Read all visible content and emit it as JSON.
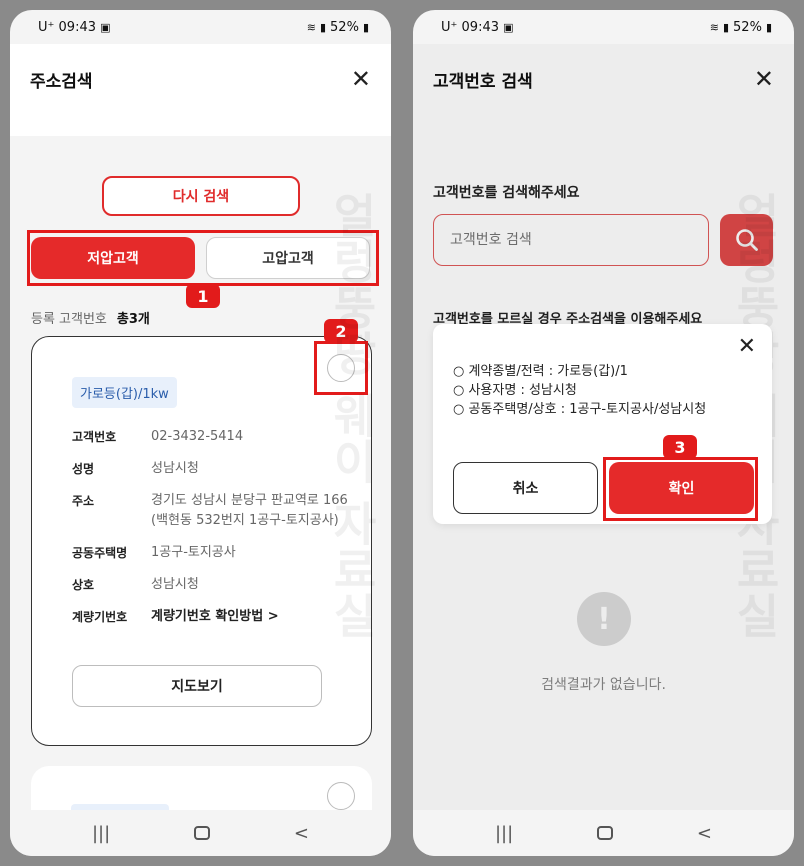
{
  "status_bar": {
    "carrier": "U⁺",
    "time": "09:43",
    "battery": "52%"
  },
  "left": {
    "title": "주소검색",
    "research_button": "다시 검색",
    "tabs": {
      "low_voltage": "저압고객",
      "high_voltage": "고압고객"
    },
    "badges": {
      "first": "1",
      "second": "2"
    },
    "count_label": "등록 고객번호",
    "count_value": "총3개",
    "card": {
      "tag": "가로등(갑)/1kw",
      "rows": [
        {
          "label": "고객번호",
          "value": "02-3432-5414"
        },
        {
          "label": "성명",
          "value": "성남시청"
        },
        {
          "label": "주소",
          "value": "경기도 성남시 분당구 판교역로 166 (백현동 532번지 1공구-토지공사)"
        },
        {
          "label": "공동주택명",
          "value": "1공구-토지공사"
        },
        {
          "label": "상호",
          "value": "성남시청"
        },
        {
          "label": "계량기번호",
          "value": "계량기번호 확인방법 >"
        }
      ],
      "map_button": "지도보기"
    }
  },
  "right": {
    "title": "고객번호 검색",
    "prompt": "고객번호를 검색해주세요",
    "search_placeholder": "고객번호 검색",
    "hint": "고객번호를 모르실 경우 주소검색을 이용해주세요",
    "modal": {
      "line1": "○ 계약종별/전력 : 가로등(갑)/1",
      "line2": "○ 사용자명 : 성남시청",
      "line3": "○ 공동주택명/상호 : 1공구-토지공사/성남시청",
      "cancel": "취소",
      "confirm": "확인",
      "badge": "3"
    },
    "empty_message": "검색결과가 없습니다."
  },
  "watermark": "얼렁뚱땅 웨이 자료실",
  "colors": {
    "accent": "#e52a2a",
    "highlight": "#e21b1b",
    "tag_bg": "#e8f0fb",
    "tag_text": "#2a5dab"
  }
}
